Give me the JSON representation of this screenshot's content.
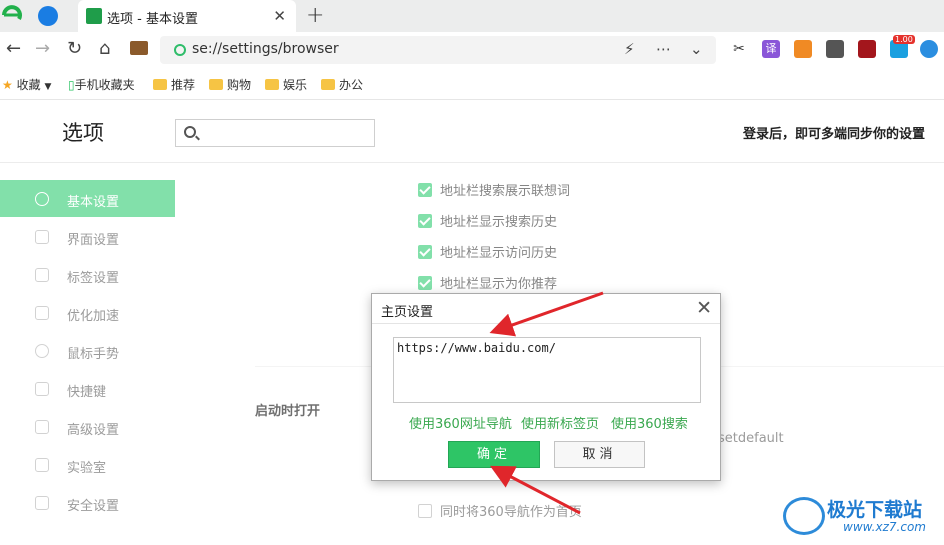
{
  "tab": {
    "title": "选项 - 基本设置",
    "close_glyph": "✕",
    "new_glyph": "+"
  },
  "address": {
    "url": "se://settings/browser"
  },
  "bookmarks": [
    {
      "label": "收藏",
      "icon": "star-icon"
    },
    {
      "label": "手机收藏夹",
      "icon": "phone-icon"
    },
    {
      "label": "推荐",
      "icon": "folder-icon"
    },
    {
      "label": "购物",
      "icon": "folder-icon"
    },
    {
      "label": "娱乐",
      "icon": "folder-icon"
    },
    {
      "label": "办公",
      "icon": "folder-icon"
    }
  ],
  "extensions": {
    "badge": "1.00",
    "translate_label": "译"
  },
  "settings": {
    "title": "选项",
    "search_placeholder": "",
    "sync_hint": "登录后，即可多端同步你的设置"
  },
  "sidebar": {
    "items": [
      {
        "label": "基本设置",
        "icon": "settings-icon",
        "active": true
      },
      {
        "label": "界面设置",
        "icon": "window-icon"
      },
      {
        "label": "标签设置",
        "icon": "tab-icon"
      },
      {
        "label": "优化加速",
        "icon": "bolt-icon"
      },
      {
        "label": "鼠标手势",
        "icon": "mouse-icon"
      },
      {
        "label": "快捷键",
        "icon": "keyboard-icon"
      },
      {
        "label": "高级设置",
        "icon": "wrench-icon"
      },
      {
        "label": "实验室",
        "icon": "flask-icon"
      },
      {
        "label": "安全设置",
        "icon": "shield-icon"
      }
    ]
  },
  "content": {
    "checks": [
      {
        "label": "地址栏搜索展示联想词",
        "checked": true
      },
      {
        "label": "地址栏显示搜索历史",
        "checked": true
      },
      {
        "label": "地址栏显示访问历史",
        "checked": true
      },
      {
        "label": "地址栏显示为你推荐",
        "checked": true
      }
    ],
    "startup_label": "启动时打开",
    "setdefault_text": "setdefault",
    "nav_home_check": "同时将360导航作为首页"
  },
  "dialog": {
    "title": "主页设置",
    "url_value": "https://www.baidu.com/",
    "links": [
      "使用360网址导航",
      "使用新标签页",
      "使用360搜索"
    ],
    "ok_label": "确定",
    "cancel_label": "取消"
  },
  "watermark": {
    "title": "极光下载站",
    "url": "www.xz7.com"
  },
  "colors": {
    "accent": "#3fcf7d",
    "ok_button": "#2ec566",
    "link": "#3aa84f",
    "arrow": "#e0262b"
  }
}
